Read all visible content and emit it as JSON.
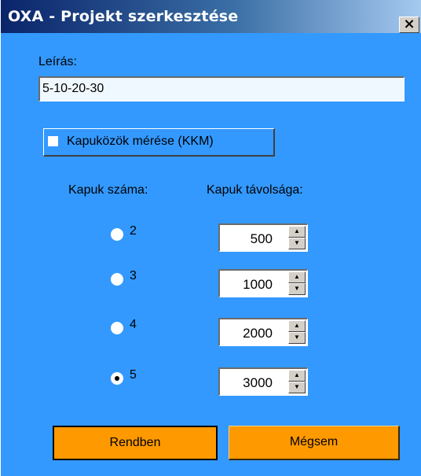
{
  "window": {
    "title": "OXA - Projekt szerkesztése",
    "close_glyph": "×"
  },
  "form": {
    "description_label": "Leírás:",
    "description_value": "5-10-20-30",
    "kkm_checkbox_label": "Kapuközök mérése (KKM)",
    "kkm_checked": false,
    "gate_count_header": "Kapuk száma:",
    "gate_distance_header": "Kapuk távolsága:",
    "gates": [
      {
        "count": "2",
        "selected": false,
        "distance": "500"
      },
      {
        "count": "3",
        "selected": false,
        "distance": "1000"
      },
      {
        "count": "4",
        "selected": false,
        "distance": "2000"
      },
      {
        "count": "5",
        "selected": true,
        "distance": "3000"
      }
    ]
  },
  "buttons": {
    "ok_label": "Rendben",
    "cancel_label": "Mégsem"
  },
  "colors": {
    "client_background": "#3399ff",
    "button_background": "#ff9900",
    "titlebar_start": "#0a246a"
  },
  "icons": {
    "close": "close-icon",
    "spin_up": "triangle-up-icon",
    "spin_down": "triangle-down-icon"
  }
}
